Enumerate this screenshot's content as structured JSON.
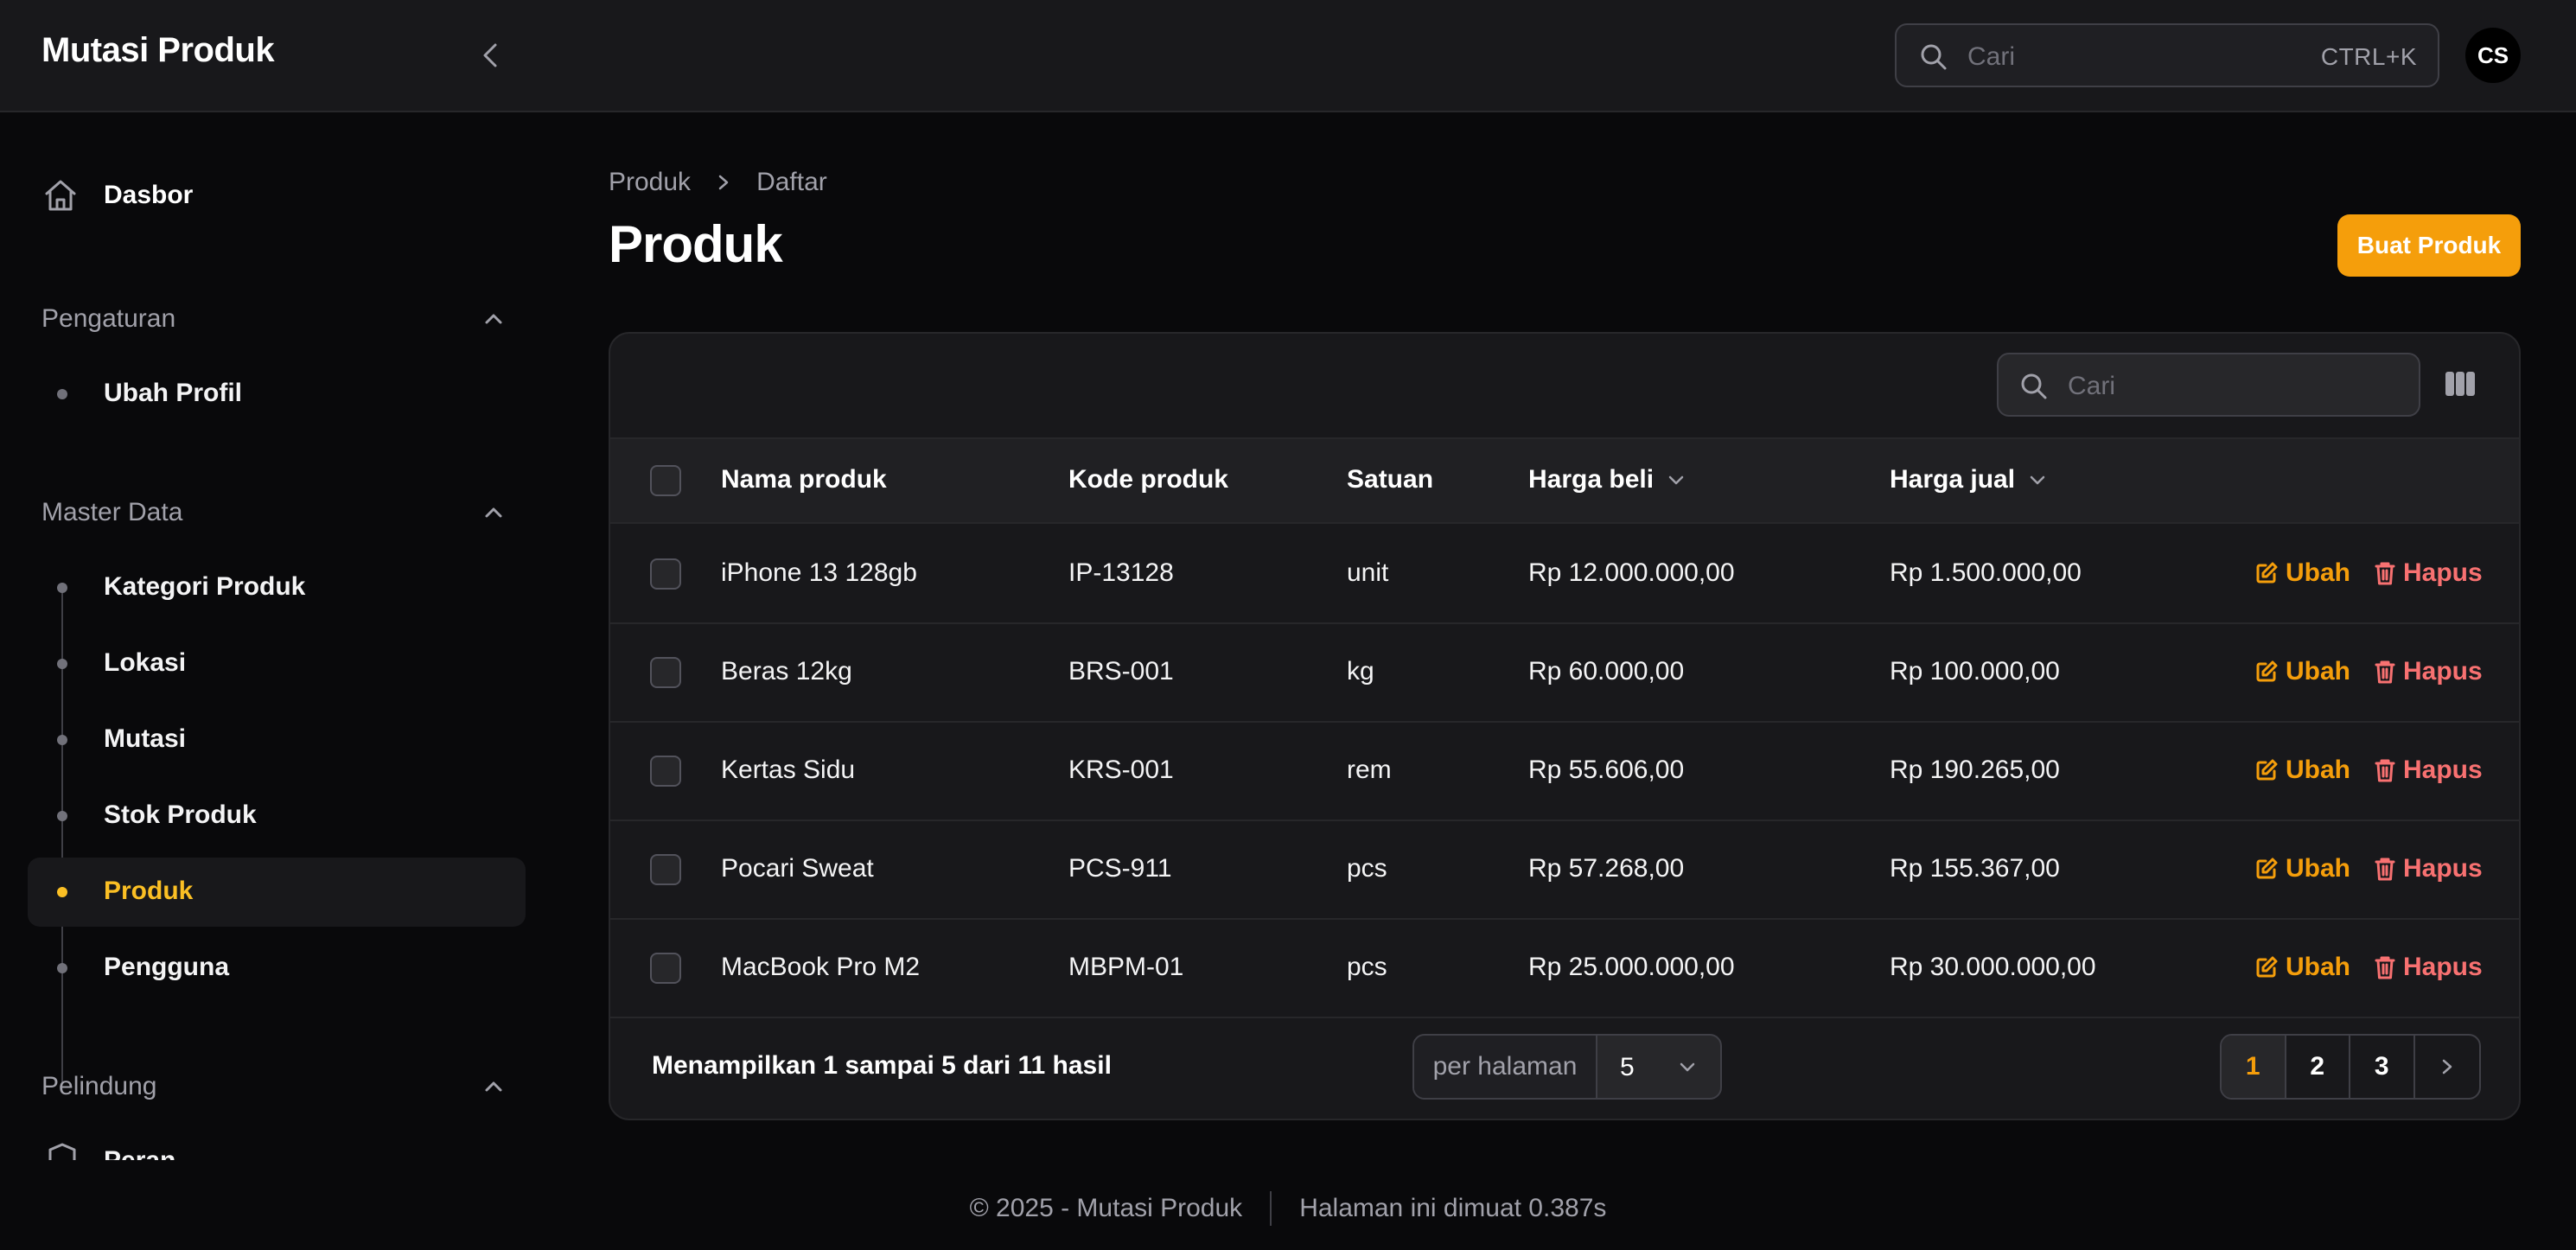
{
  "app": {
    "title": "Mutasi Produk",
    "search_placeholder": "Cari",
    "search_shortcut": "CTRL+K",
    "avatar_initials": "CS"
  },
  "sidebar": {
    "dashboard": "Dasbor",
    "groups": [
      {
        "label": "Pengaturan",
        "items": [
          "Ubah Profil"
        ]
      },
      {
        "label": "Master Data",
        "items": [
          "Kategori Produk",
          "Lokasi",
          "Mutasi",
          "Stok Produk",
          "Produk",
          "Pengguna"
        ],
        "active": "Produk"
      },
      {
        "label": "Pelindung",
        "items": [
          "Peran"
        ]
      }
    ]
  },
  "page": {
    "breadcrumb": [
      "Produk",
      "Daftar"
    ],
    "title": "Produk",
    "create_button": "Buat Produk"
  },
  "table": {
    "search_placeholder": "Cari",
    "columns": [
      "Nama produk",
      "Kode produk",
      "Satuan",
      "Harga beli",
      "Harga jual"
    ],
    "rows": [
      {
        "name": "iPhone 13 128gb",
        "code": "IP-13128",
        "unit": "unit",
        "buy": "Rp 12.000.000,00",
        "sell": "Rp 1.500.000,00"
      },
      {
        "name": "Beras 12kg",
        "code": "BRS-001",
        "unit": "kg",
        "buy": "Rp 60.000,00",
        "sell": "Rp 100.000,00"
      },
      {
        "name": "Kertas Sidu",
        "code": "KRS-001",
        "unit": "rem",
        "buy": "Rp 55.606,00",
        "sell": "Rp 190.265,00"
      },
      {
        "name": "Pocari Sweat",
        "code": "PCS-911",
        "unit": "pcs",
        "buy": "Rp 57.268,00",
        "sell": "Rp 155.367,00"
      },
      {
        "name": "MacBook Pro M2",
        "code": "MBPM-01",
        "unit": "pcs",
        "buy": "Rp 25.000.000,00",
        "sell": "Rp 30.000.000,00"
      }
    ],
    "edit_label": "Ubah",
    "delete_label": "Hapus",
    "summary": "Menampilkan 1 sampai 5 dari 11 hasil",
    "per_page_label": "per halaman",
    "per_page_value": "5",
    "pages": [
      "1",
      "2",
      "3"
    ],
    "current_page": "1"
  },
  "footer": {
    "copyright": "© 2025 - Mutasi Produk",
    "load_time": "Halaman ini dimuat 0.387s"
  },
  "colors": {
    "accent": "#f59e0b",
    "danger": "#f87171",
    "background": "#09090b",
    "surface": "#18181b"
  }
}
